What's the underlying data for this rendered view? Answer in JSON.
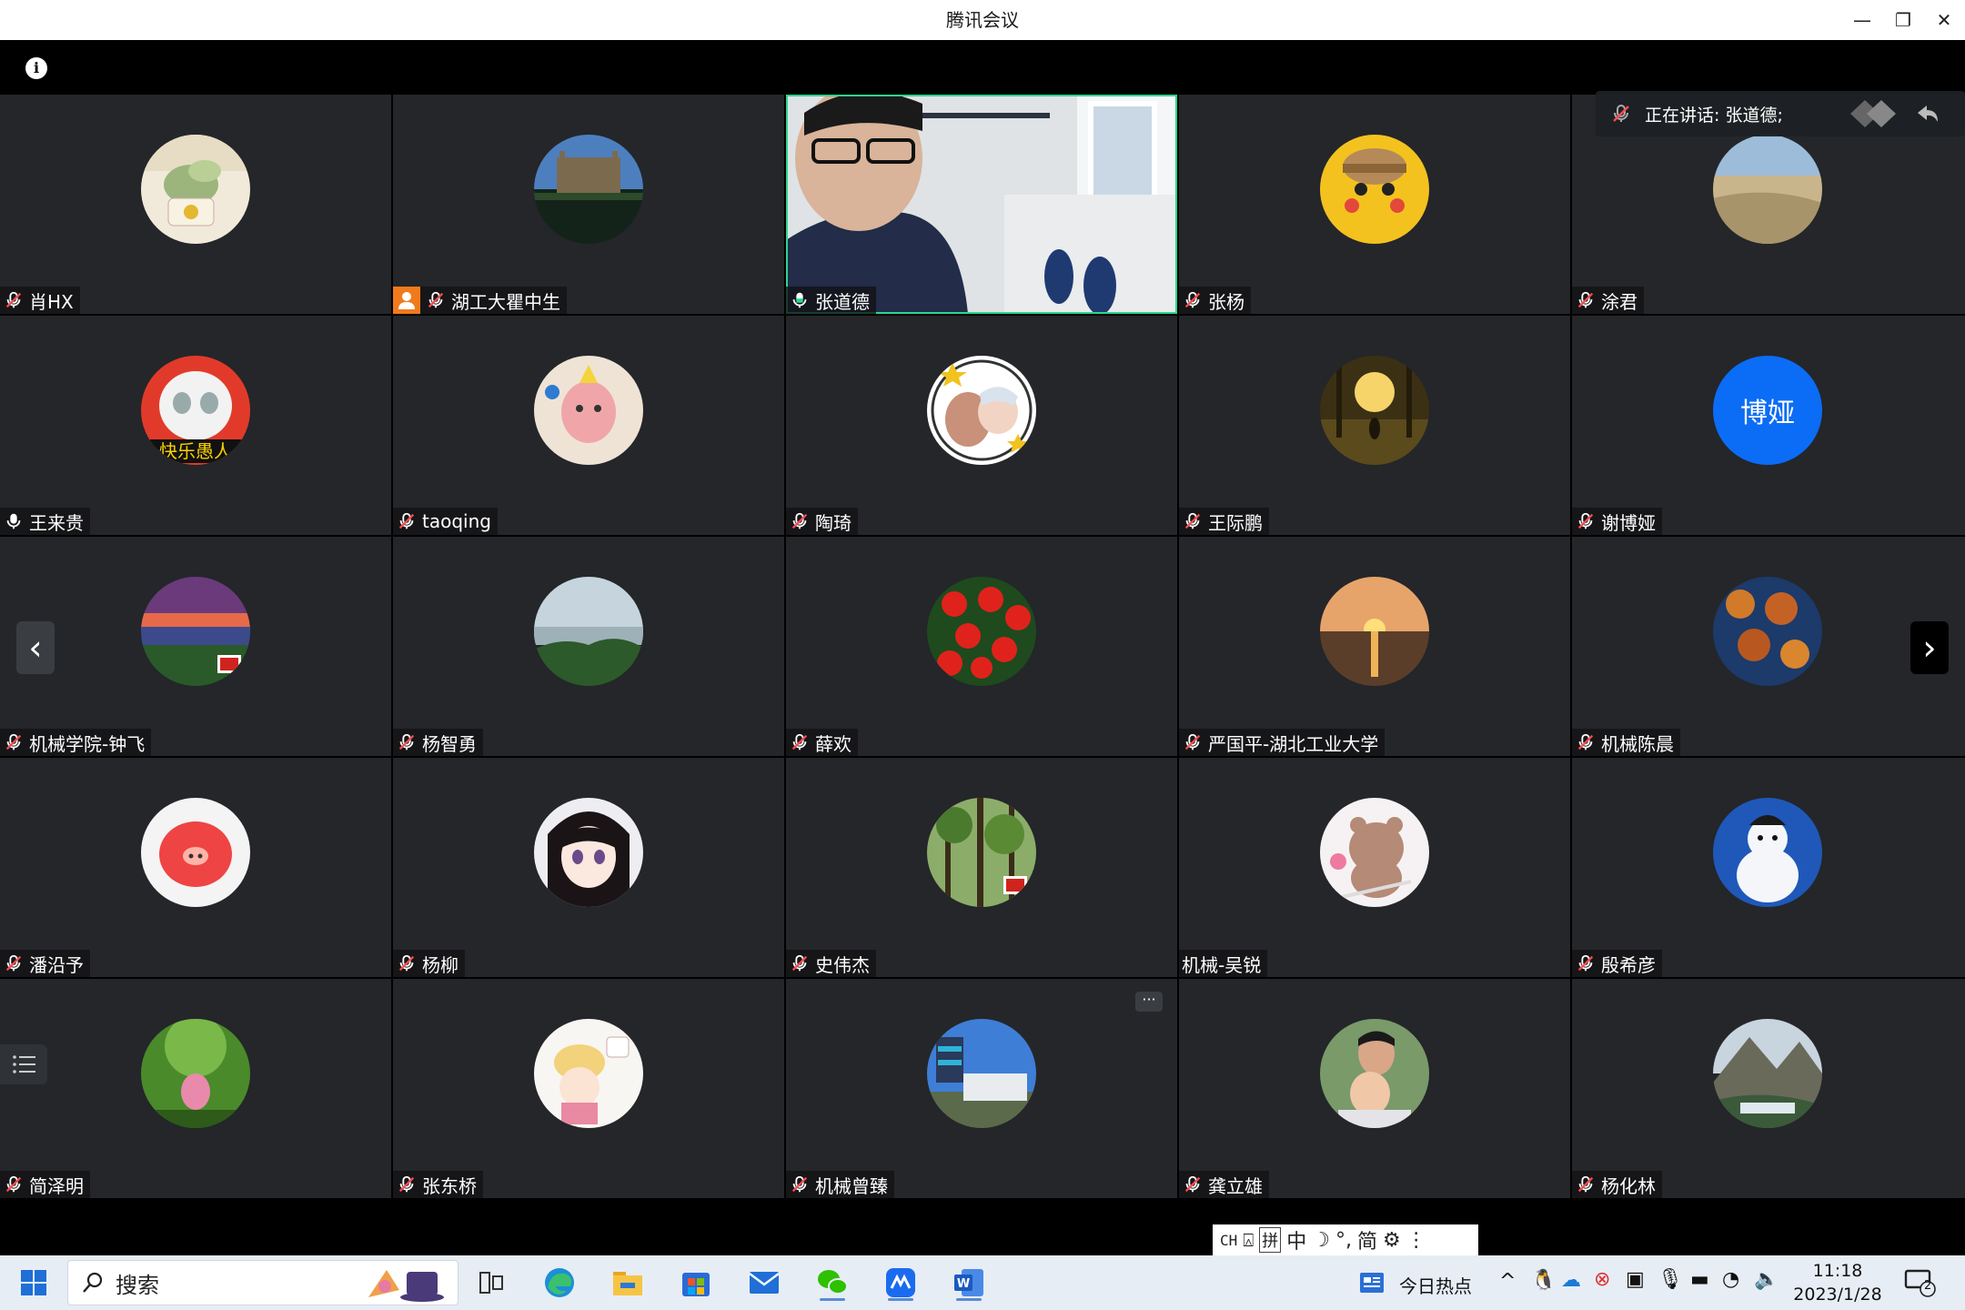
{
  "window": {
    "title": "腾讯会议",
    "minimize": "—",
    "restore": "❐",
    "close": "✕"
  },
  "speaking": {
    "text": "正在讲话: 张道德;"
  },
  "participants": [
    {
      "name": "肖HX",
      "mic": "muted"
    },
    {
      "name": "湖工大瞿中生",
      "mic": "muted",
      "host": true
    },
    {
      "name": "张道德",
      "mic": "on",
      "video": true
    },
    {
      "name": "张杨",
      "mic": "muted"
    },
    {
      "name": "涂君",
      "mic": "muted"
    },
    {
      "name": "王来贵",
      "mic": "on"
    },
    {
      "name": "taoqing",
      "mic": "muted"
    },
    {
      "name": "陶琦",
      "mic": "muted"
    },
    {
      "name": "王际鹏",
      "mic": "muted"
    },
    {
      "name": "谢博娅",
      "mic": "muted",
      "avatar_text": "博娅"
    },
    {
      "name": "机械学院-钟飞",
      "mic": "muted"
    },
    {
      "name": "杨智勇",
      "mic": "muted"
    },
    {
      "name": "薛欢",
      "mic": "muted"
    },
    {
      "name": "严国平-湖北工业大学",
      "mic": "muted"
    },
    {
      "name": "机械陈晨",
      "mic": "muted"
    },
    {
      "name": "潘沿予",
      "mic": "muted"
    },
    {
      "name": "杨柳",
      "mic": "muted"
    },
    {
      "name": "史伟杰",
      "mic": "muted"
    },
    {
      "name": "机械-吴锐",
      "mic": "none"
    },
    {
      "name": "殷希彦",
      "mic": "muted"
    },
    {
      "name": "简泽明",
      "mic": "muted"
    },
    {
      "name": "张东桥",
      "mic": "muted"
    },
    {
      "name": "机械曾臻",
      "mic": "muted"
    },
    {
      "name": "龚立雄",
      "mic": "muted"
    },
    {
      "name": "杨化林",
      "mic": "muted"
    }
  ],
  "controls": {
    "prev_page": "‹",
    "next_page": "›",
    "more": "···"
  },
  "ime": {
    "lang": "CH",
    "mode": "拼",
    "chinese": "中",
    "simplified": "简"
  },
  "taskbar": {
    "search_placeholder": "搜索",
    "news": "今日热点",
    "time": "11:18",
    "date": "2023/1/28",
    "notification_count": "2"
  },
  "colors": {
    "tile_bg": "#24262a",
    "speaking_border": "#2bd68c",
    "avatar_blue": "#0b6cf6",
    "host_badge": "#f07a1c"
  }
}
